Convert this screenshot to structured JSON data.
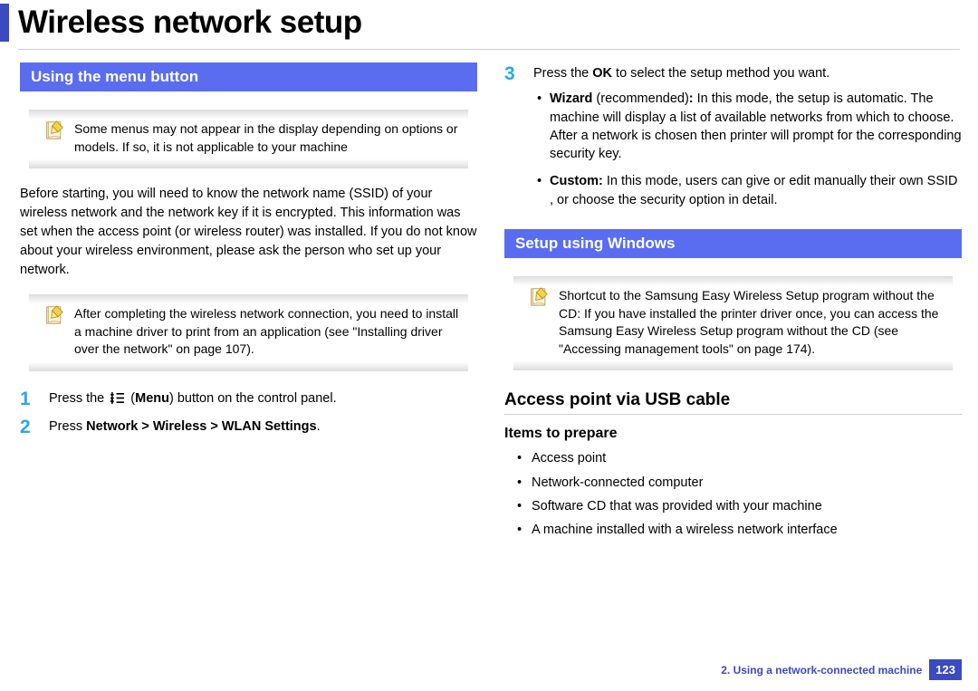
{
  "page_title": "Wireless network setup",
  "left": {
    "section_header": "Using the menu button",
    "note1": "Some menus may not appear in the display depending on options or models. If so, it is not applicable to your machine",
    "intro": "Before starting, you will need to know the network name (SSID) of your wireless network and the network key if it is encrypted. This information was set when the access point (or wireless router) was installed. If you do not know about your wireless environment, please ask the person who set up your network.",
    "note2": "After completing the wireless network connection, you need to install a machine driver to print from an application (see \"Installing driver over the network\" on page 107).",
    "step1_pre": "Press the ",
    "step1_mid": " (",
    "step1_b": "Menu",
    "step1_post": ") button on the control panel.",
    "step2_pre": "Press ",
    "step2_b": "Network > Wireless > WLAN Settings",
    "step2_post": "."
  },
  "right": {
    "step3_pre": "Press the ",
    "step3_b": "OK",
    "step3_post": " to select the setup method you want.",
    "wizard_b": "Wizard",
    "wizard_rec": " (recommended)",
    "wizard_colon_b": ":",
    "wizard_text": " In this mode, the setup is automatic. The machine will display a list of available networks from which to choose. After a network is chosen then printer will prompt for the corresponding security key.",
    "custom_b": "Custom:",
    "custom_text": " In this mode, users can give or edit manually their own SSID , or choose the security option in detail.",
    "section_header": "Setup using Windows",
    "note": "Shortcut to the Samsung Easy Wireless Setup program without the CD: If you have installed the printer driver once, you can access the Samsung Easy Wireless Setup program without the CD (see \"Accessing management tools\" on page 174).",
    "sub1": "Access point via USB cable",
    "sub2": "Items to prepare",
    "items": [
      "Access point",
      "Network-connected computer",
      "Software CD that was provided with your machine",
      "A machine installed with a wireless network interface"
    ]
  },
  "footer": {
    "chapter": "2.  Using a network-connected machine",
    "page": "123"
  }
}
